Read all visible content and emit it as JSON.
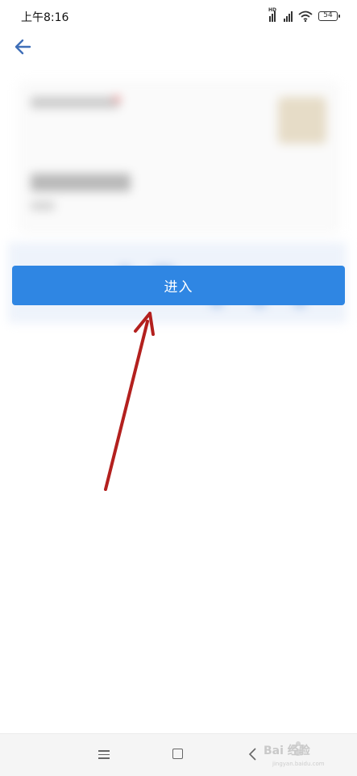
{
  "status_bar": {
    "time": "上午8:16",
    "hd_label": "HD",
    "battery_level": "54"
  },
  "main": {
    "enter_button_label": "进入"
  },
  "watermark": {
    "text": "Bai 经验",
    "sub": "jingyan.baidu.com"
  },
  "colors": {
    "primary_button": "#2f86e3",
    "annotation_arrow": "#b3201e"
  }
}
